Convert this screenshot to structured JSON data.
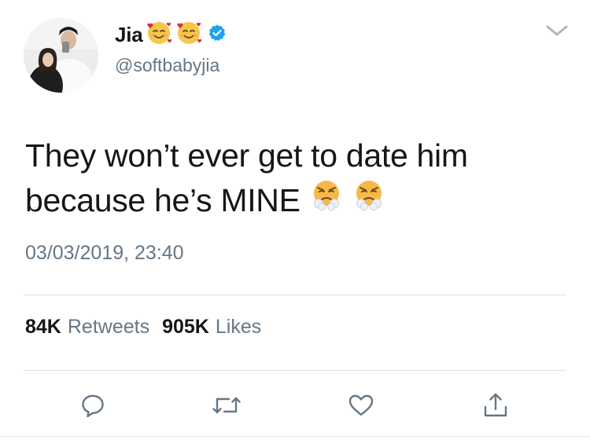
{
  "user": {
    "display_name": "Jia",
    "handle": "@softbabyjia",
    "verified": true,
    "name_emojis": [
      "smiling-face-with-hearts",
      "smiling-face-with-hearts"
    ]
  },
  "tweet": {
    "text_line1": "They won’t ever get to date him",
    "text_line2": "because he’s MINE",
    "text_emojis": [
      "face-with-steam-from-nose",
      "face-with-steam-from-nose"
    ],
    "timestamp": "03/03/2019, 23:40"
  },
  "stats": {
    "retweets_count": "84K",
    "retweets_label": "Retweets",
    "likes_count": "905K",
    "likes_label": "Likes"
  },
  "actions": [
    "reply-icon",
    "retweet-icon",
    "like-icon",
    "share-icon"
  ],
  "colors": {
    "text": "#14171a",
    "secondary": "#657786",
    "verified": "#1da1f2",
    "divider": "#dcdfe3"
  }
}
